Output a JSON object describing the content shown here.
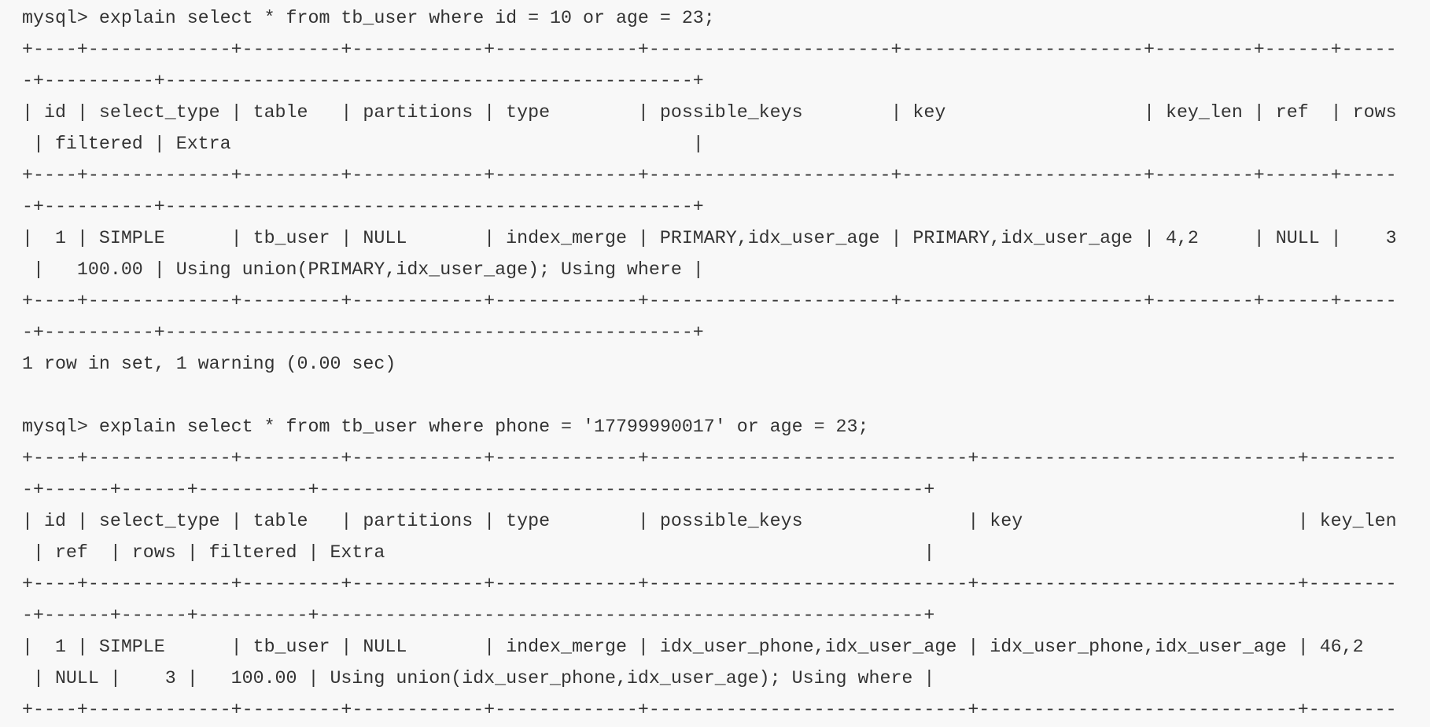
{
  "colors": {
    "background": "#f8f8f8",
    "text": "#333333"
  },
  "queries": [
    {
      "command": "mysql> explain select * from tb_user where id = 10 or age = 23;",
      "sep_top_1": "+----+-------------+---------+------------+-------------+----------------------+----------------------+---------+------+-----",
      "sep_top_2": "-+----------+------------------------------------------------+",
      "header_1": "| id | select_type | table   | partitions | type        | possible_keys        | key                  | key_len | ref  | rows",
      "header_2": " | filtered | Extra                                          |",
      "sep_mid_1": "+----+-------------+---------+------------+-------------+----------------------+----------------------+---------+------+-----",
      "sep_mid_2": "-+----------+------------------------------------------------+",
      "row_1": "|  1 | SIMPLE      | tb_user | NULL       | index_merge | PRIMARY,idx_user_age | PRIMARY,idx_user_age | 4,2     | NULL |    3",
      "row_2": " |   100.00 | Using union(PRIMARY,idx_user_age); Using where |",
      "sep_bot_1": "+----+-------------+---------+------------+-------------+----------------------+----------------------+---------+------+-----",
      "sep_bot_2": "-+----------+------------------------------------------------+",
      "result": "1 row in set, 1 warning (0.00 sec)"
    },
    {
      "command": "mysql> explain select * from tb_user where phone = '17799990017' or age = 23;",
      "sep_top_1": "+----+-------------+---------+------------+-------------+-----------------------------+-----------------------------+--------",
      "sep_top_2": "-+------+------+----------+-------------------------------------------------------+",
      "header_1": "| id | select_type | table   | partitions | type        | possible_keys               | key                         | key_len",
      "header_2": " | ref  | rows | filtered | Extra                                                 |",
      "sep_mid_1": "+----+-------------+---------+------------+-------------+-----------------------------+-----------------------------+--------",
      "sep_mid_2": "-+------+------+----------+-------------------------------------------------------+",
      "row_1": "|  1 | SIMPLE      | tb_user | NULL       | index_merge | idx_user_phone,idx_user_age | idx_user_phone,idx_user_age | 46,2",
      "row_2": " | NULL |    3 |   100.00 | Using union(idx_user_phone,idx_user_age); Using where |",
      "sep_bot_1": "+----+-------------+---------+------------+-------------+-----------------------------+-----------------------------+--------"
    }
  ]
}
